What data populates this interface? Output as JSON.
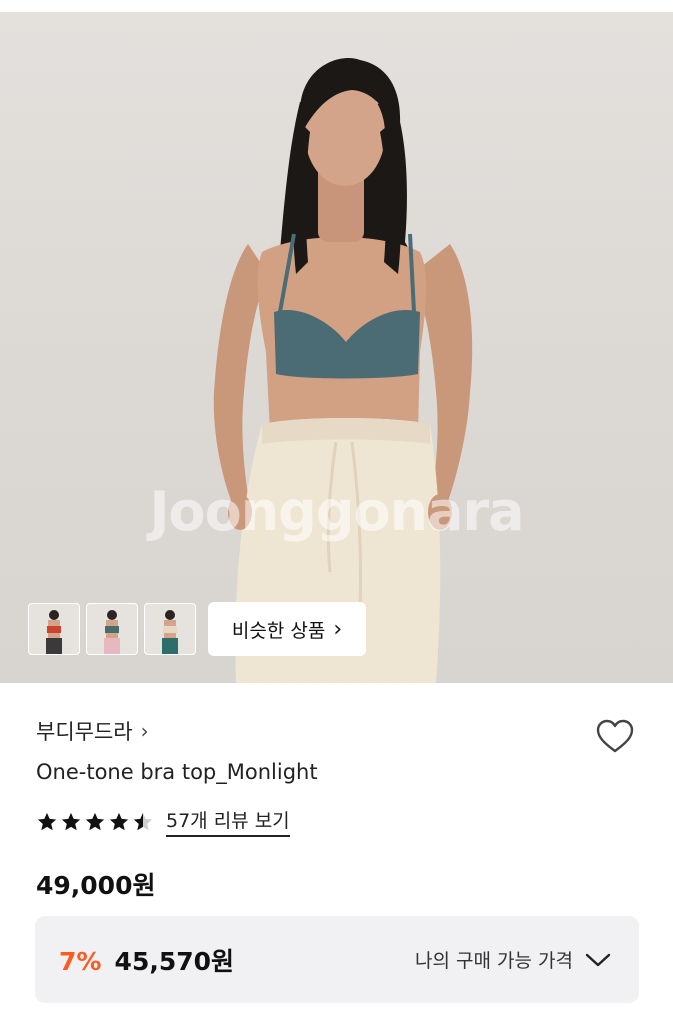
{
  "product": {
    "watermark": "Joonggonara",
    "similar_button_label": "비슷한 상품",
    "brand": "부디무드라",
    "name": "One-tone bra top_Monlight",
    "rating": 4.5,
    "review_link": "57개 리뷰 보기",
    "price": "49,000원",
    "discount_percent": "7%",
    "discount_price": "45,570원",
    "my_price_label": "나의 구매 가능 가격"
  },
  "thumbnails": [
    {
      "name": "thumbnail-red-top",
      "top_color": "#c9442f",
      "bottom_color": "#3a3a3a"
    },
    {
      "name": "thumbnail-teal-top-pink-pants",
      "top_color": "#4a6b6b",
      "bottom_color": "#e6b8bf"
    },
    {
      "name": "thumbnail-beige-top-teal-pants",
      "top_color": "#e7d7c3",
      "bottom_color": "#2e6e6a"
    }
  ],
  "colors": {
    "accent_orange": "#ff5a1f",
    "price_box_bg": "#f1f1f3",
    "bra_teal": "#4b6b75",
    "pants_cream": "#efe5d3"
  },
  "icons": [
    "chevron-right-icon",
    "heart-outline-icon",
    "star-icon",
    "chevron-down-icon"
  ]
}
